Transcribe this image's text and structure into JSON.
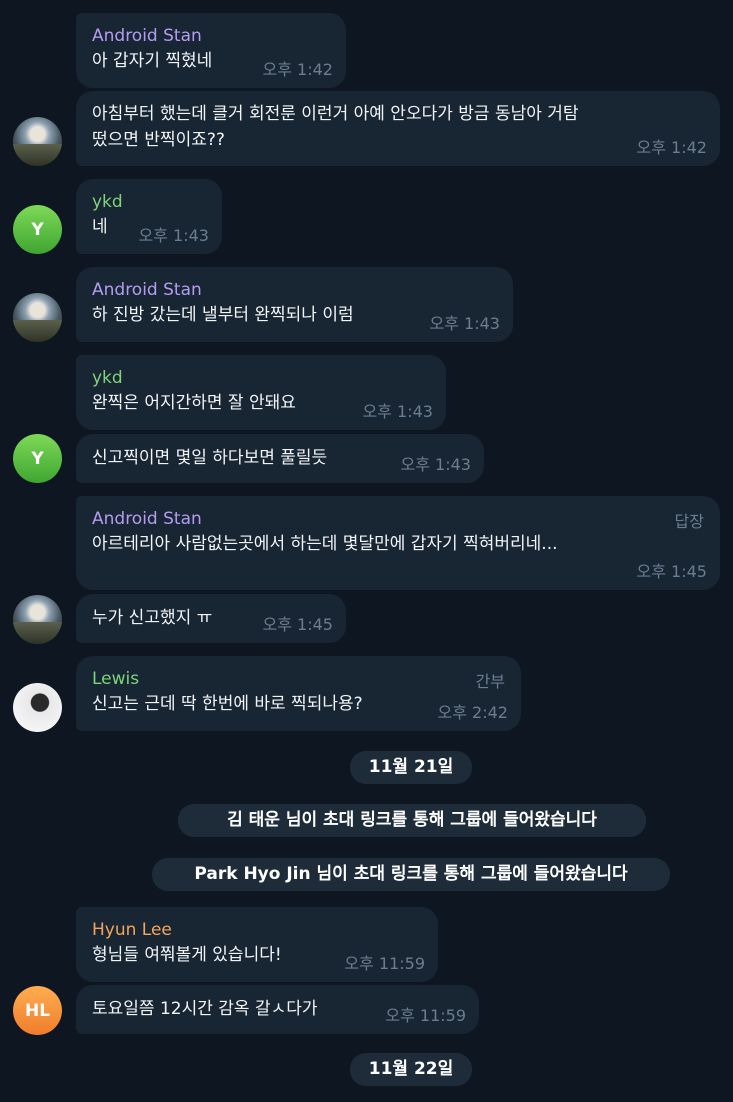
{
  "colors": {
    "background": "#0e1621",
    "bubble": "#182533",
    "sender_android_stan": "#b49cf0",
    "sender_ykd": "#7ed47a",
    "sender_lewis": "#7ed47a",
    "sender_hyun_lee": "#f5a45d",
    "avatar_ykd": "#5cc243",
    "avatar_hl": "#f5953f"
  },
  "messages": [
    {
      "sender": "Android Stan",
      "text": "아 갑자기 찍혔네",
      "time": "오후 1:42"
    },
    {
      "text_line1": "아침부터 했는데 클거 회전룬 이런거 아예 안오다가 방금 동남아 거탐",
      "text_line2": "떴으면 반찍이죠??",
      "time": "오후 1:42",
      "avatar_icon": "user-photo-avatar"
    },
    {
      "sender": "ykd",
      "text": "네",
      "time": "오후 1:43",
      "avatar_initial": "Y"
    },
    {
      "sender": "Android Stan",
      "text": "하 진방 갔는데 낼부터 완찍되나 이럼",
      "time": "오후 1:43",
      "avatar_icon": "user-photo-avatar"
    },
    {
      "sender": "ykd",
      "text": "완찍은 어지간하면 잘 안돼요",
      "time": "오후 1:43"
    },
    {
      "text": "신고찍이면 몇일 하다보면 풀릴듯",
      "time": "오후 1:43",
      "avatar_initial": "Y"
    },
    {
      "sender": "Android Stan",
      "tag": "답장",
      "text": "아르테리아 사람없는곳에서 하는데 몇달만에 갑자기 찍혀버리네...",
      "time": "오후 1:45"
    },
    {
      "text": "누가 신고했지 ㅠ",
      "time": "오후 1:45",
      "avatar_icon": "user-photo-avatar"
    },
    {
      "sender": "Lewis",
      "tag": "간부",
      "text": "신고는 근데 딱 한번에 바로 찍되나용?",
      "time": "오후 2:42",
      "avatar_icon": "user-photo-avatar"
    },
    {
      "sender": "Hyun Lee",
      "text": "형님들 여쭤볼게 있습니다!",
      "time": "오후 11:59"
    },
    {
      "text": "토요일쯤 12시간 감옥 갈ㅅ다가",
      "time": "오후 11:59",
      "avatar_initial": "HL"
    }
  ],
  "service": {
    "date1": "11월 21일",
    "join1": "김 태운 님이 초대 링크를 통해 그룹에 들어왔습니다",
    "join2": "Park Hyo Jin 님이 초대 링크를 통해 그룹에 들어왔습니다",
    "date2": "11월 22일"
  }
}
